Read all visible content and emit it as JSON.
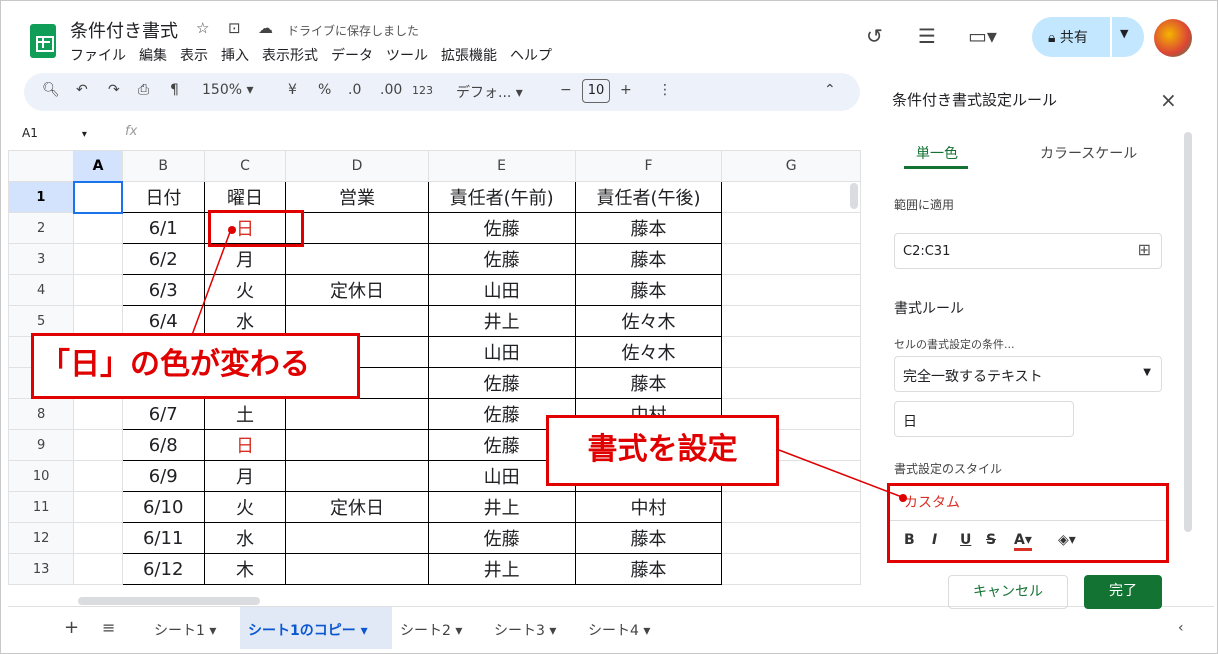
{
  "header": {
    "doc_title": "条件付き書式",
    "save_status": "ドライブに保存しました",
    "menu": [
      "ファイル",
      "編集",
      "表示",
      "挿入",
      "表示形式",
      "データ",
      "ツール",
      "拡張機能",
      "ヘルプ"
    ],
    "share_label": "共有"
  },
  "toolbar": {
    "zoom": "150%",
    "currency": "¥",
    "percent": "%",
    "dec_dec": ".0",
    "dec_inc": ".00",
    "number_fmt": "123",
    "font": "デフォ...",
    "font_size": "10"
  },
  "formula_bar": {
    "cell_ref": "A1",
    "fx": "fx"
  },
  "grid": {
    "columns": [
      "A",
      "B",
      "C",
      "D",
      "E",
      "F",
      "G"
    ],
    "rows": [
      {
        "n": "1",
        "b": "日付",
        "c": "曜日",
        "d": "営業",
        "e": "責任者(午前)",
        "f": "責任者(午後)"
      },
      {
        "n": "2",
        "b": "6/1",
        "c": "日",
        "d": "",
        "e": "佐藤",
        "f": "藤本"
      },
      {
        "n": "3",
        "b": "6/2",
        "c": "月",
        "d": "",
        "e": "佐藤",
        "f": "藤本"
      },
      {
        "n": "4",
        "b": "6/3",
        "c": "火",
        "d": "定休日",
        "e": "山田",
        "f": "藤本"
      },
      {
        "n": "5",
        "b": "6/4",
        "c": "水",
        "d": "",
        "e": "井上",
        "f": "佐々木"
      },
      {
        "n": "6",
        "b": "",
        "c": "",
        "d": "",
        "e": "山田",
        "f": "佐々木"
      },
      {
        "n": "7",
        "b": "",
        "c": "",
        "d": "",
        "e": "佐藤",
        "f": "藤本"
      },
      {
        "n": "8",
        "b": "6/7",
        "c": "土",
        "d": "",
        "e": "佐藤",
        "f": "中村"
      },
      {
        "n": "9",
        "b": "6/8",
        "c": "日",
        "d": "",
        "e": "佐藤",
        "f": ""
      },
      {
        "n": "10",
        "b": "6/9",
        "c": "月",
        "d": "",
        "e": "山田",
        "f": ""
      },
      {
        "n": "11",
        "b": "6/10",
        "c": "火",
        "d": "定休日",
        "e": "井上",
        "f": "中村"
      },
      {
        "n": "12",
        "b": "6/11",
        "c": "水",
        "d": "",
        "e": "佐藤",
        "f": "藤本"
      },
      {
        "n": "13",
        "b": "6/12",
        "c": "木",
        "d": "",
        "e": "井上",
        "f": "藤本"
      }
    ]
  },
  "sheet_tabs": [
    "シート1",
    "シート1のコピー",
    "シート2",
    "シート3",
    "シート4"
  ],
  "panel": {
    "title": "条件付き書式設定ルール",
    "tab_single": "単一色",
    "tab_scale": "カラースケール",
    "range_label": "範囲に適用",
    "range_value": "C2:C31",
    "rules_label": "書式ルール",
    "condition_label": "セルの書式設定の条件...",
    "condition_value": "完全一致するテキスト",
    "value": "日",
    "style_label": "書式設定のスタイル",
    "style_value": "カスタム",
    "cancel": "キャンセル",
    "done": "完了"
  },
  "annotations": {
    "callout1": "「日」の色が変わる",
    "callout2": "書式を設定"
  },
  "colors": {
    "accent_red": "#e00000",
    "sheets_green": "#137333",
    "share_blue": "#c2e7ff"
  }
}
